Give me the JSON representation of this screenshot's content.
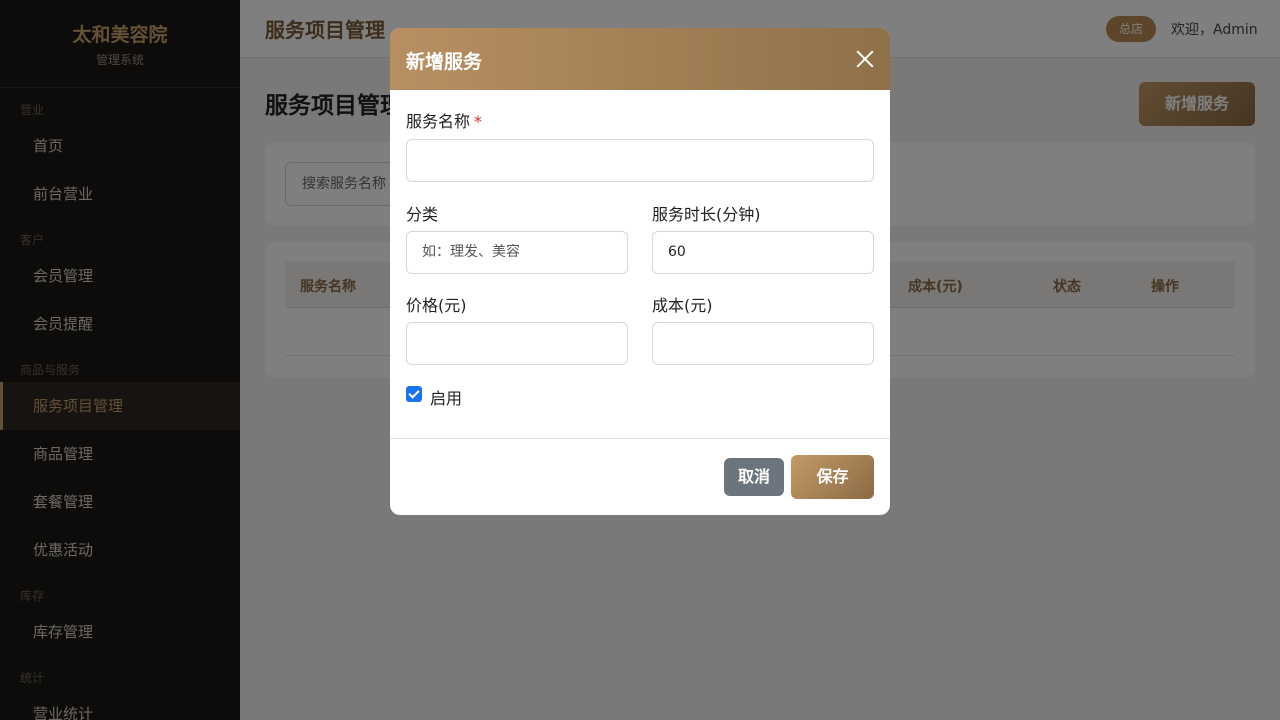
{
  "brand": {
    "name": "太和美容院",
    "subtitle": "管理系统"
  },
  "sidebar": {
    "groups": [
      {
        "label": "营业",
        "items": [
          "首页",
          "前台营业"
        ]
      },
      {
        "label": "客户",
        "items": [
          "会员管理",
          "会员提醒"
        ]
      },
      {
        "label": "商品与服务",
        "items": [
          "服务项目管理",
          "商品管理",
          "套餐管理",
          "优惠活动"
        ]
      },
      {
        "label": "库存",
        "items": [
          "库存管理"
        ]
      },
      {
        "label": "统计",
        "items": [
          "营业统计"
        ]
      }
    ],
    "active_item": "服务项目管理"
  },
  "header": {
    "title": "服务项目管理",
    "store_badge": "总店",
    "welcome": "欢迎，Admin"
  },
  "main": {
    "page_title": "服务项目管理",
    "add_button": "新增服务",
    "search_placeholder": "搜索服务名称",
    "table_headers": [
      "服务名称",
      "成本(元)",
      "状态",
      "操作"
    ]
  },
  "modal": {
    "title": "新增服务",
    "fields": {
      "name": {
        "label": "服务名称",
        "required_mark": "*",
        "value": ""
      },
      "category": {
        "label": "分类",
        "placeholder": "如：理发、美容",
        "value": ""
      },
      "duration": {
        "label": "服务时长(分钟)",
        "value": "60"
      },
      "price": {
        "label": "价格(元)",
        "value": ""
      },
      "cost": {
        "label": "成本(元)",
        "value": ""
      }
    },
    "enabled": {
      "label": "启用",
      "checked": true
    },
    "cancel": "取消",
    "save": "保存"
  },
  "colors": {
    "accent": "#b88a55",
    "sidebar_bg": "#1b1917",
    "checkbox": "#1a73e8",
    "cancel_btn": "#6c757d"
  }
}
